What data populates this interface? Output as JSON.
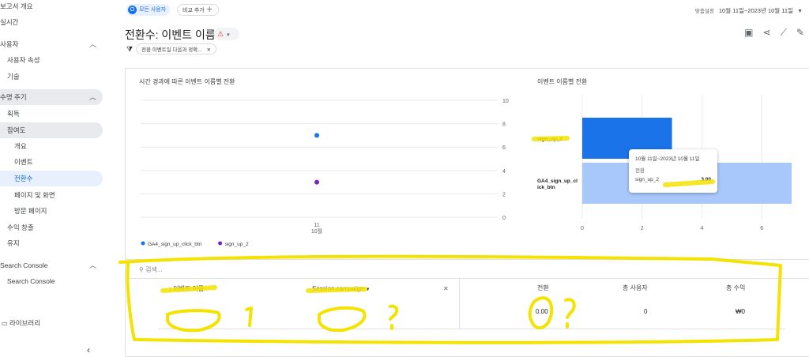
{
  "sidebar": {
    "items": [
      {
        "label": "보고서 개요"
      },
      {
        "label": "실시간"
      },
      {
        "label": "사용자"
      },
      {
        "label": "사용자 속성"
      },
      {
        "label": "기술"
      },
      {
        "label": "수명 주기"
      },
      {
        "label": "획득"
      },
      {
        "label": "참여도"
      },
      {
        "label": "개요"
      },
      {
        "label": "이벤트"
      },
      {
        "label": "전환수"
      },
      {
        "label": "페이지 및 화면"
      },
      {
        "label": "방문 페이지"
      },
      {
        "label": "수익 창출"
      },
      {
        "label": "유지"
      },
      {
        "label": "Search Console"
      },
      {
        "label": "Search Console"
      }
    ],
    "library": "라이브러리"
  },
  "topbar": {
    "all_users": "모든 사용자",
    "compare": "비교 추가",
    "date_custom": "맞춤설정",
    "date_range": "10월 11일~2023년 10월 11일"
  },
  "page": {
    "title": "전환수: 이벤트 이름",
    "filter": "전환 이벤트일 다음과 정확..."
  },
  "line_chart": {
    "title": "시간 경과에 따른 이벤트 이름별 전환",
    "x_tick_day": "11",
    "x_tick_month": "10월"
  },
  "bar_chart": {
    "title": "이벤트 이름별 전환",
    "tooltip": {
      "date": "10월 11일~2023년 10월 11일",
      "metric": "전환",
      "name": "sign_up_2",
      "value": "3.00"
    }
  },
  "chart_data": [
    {
      "type": "scatter",
      "title": "시간 경과에 따른 이벤트 이름별 전환",
      "x": [
        "11 10월"
      ],
      "ylim": [
        0,
        10
      ],
      "yticks": [
        "10",
        "8",
        "6",
        "4",
        "2",
        "0"
      ],
      "series": [
        {
          "name": "GA4_sign_up_click_btn",
          "values": [
            7
          ],
          "color": "#1a73e8"
        },
        {
          "name": "sign_up_2",
          "values": [
            3
          ],
          "color": "#7627bb"
        }
      ],
      "legend_position": "bottom-left",
      "grid": true
    },
    {
      "type": "bar",
      "orientation": "horizontal",
      "title": "이벤트 이름별 전환",
      "categories": [
        "sign_up_2",
        "GA4_sign_up_click_btn"
      ],
      "category_labels": [
        "sign_up_2",
        "GA4_sign_up_cl\nick_btn"
      ],
      "values": [
        3,
        7
      ],
      "xlim": [
        0,
        7
      ],
      "xticks": [
        "0",
        "2",
        "4",
        "6"
      ],
      "colors": [
        "#1a73e8",
        "#a8c7fa"
      ],
      "grid": true
    }
  ],
  "table": {
    "search_placeholder": "검색...",
    "headers": {
      "event_name": "이벤트 이름",
      "session_campaign": "Session campaign",
      "conversions": "전환",
      "total_users": "총 사용자",
      "total_revenue": "총 수익"
    },
    "totals": {
      "conversions": "0.00",
      "total_users": "0",
      "total_revenue": "₩0"
    }
  }
}
